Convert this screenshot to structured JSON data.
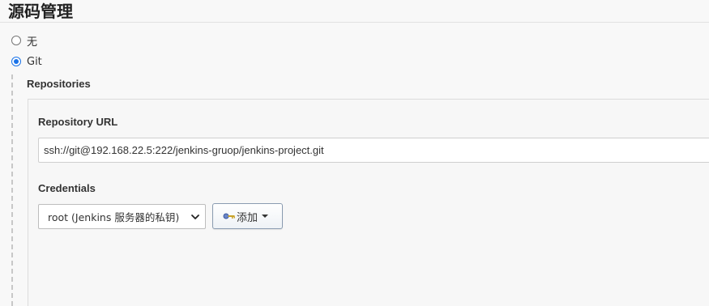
{
  "section": {
    "title": "源码管理"
  },
  "scm_options": [
    {
      "label": "无",
      "selected": false
    },
    {
      "label": "Git",
      "selected": true
    }
  ],
  "git": {
    "repositories_label": "Repositories",
    "repository_url_label": "Repository URL",
    "repository_url_value": "ssh://git@192.168.22.5:222/jenkins-gruop/jenkins-project.git",
    "credentials_label": "Credentials",
    "credentials_selected": "root (Jenkins 服务器的私钥)",
    "add_button_label": "添加",
    "add_button_icon": "key-icon"
  },
  "colors": {
    "radio_accent": "#1a73e8",
    "background": "#f8f8f8"
  }
}
